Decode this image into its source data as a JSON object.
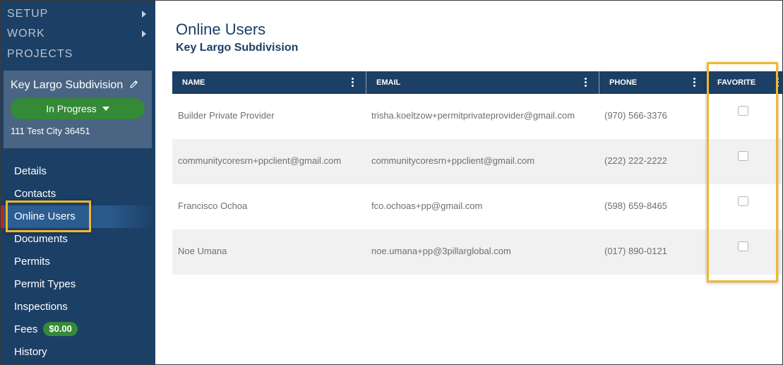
{
  "sidebar": {
    "top_nav": [
      {
        "label": "SETUP",
        "has_arrow": true
      },
      {
        "label": "WORK",
        "has_arrow": true
      },
      {
        "label": "PROJECTS",
        "has_arrow": false
      }
    ],
    "project": {
      "title": "Key Largo Subdivision",
      "edit_icon": "pencil-icon",
      "status": "In Progress",
      "address": "111 Test City 36451"
    },
    "items": [
      {
        "label": "Details"
      },
      {
        "label": "Contacts"
      },
      {
        "label": "Online Users",
        "active": true
      },
      {
        "label": "Documents"
      },
      {
        "label": "Permits"
      },
      {
        "label": "Permit Types"
      },
      {
        "label": "Inspections"
      },
      {
        "label": "Fees",
        "badge": "$0.00"
      },
      {
        "label": "History"
      }
    ]
  },
  "main": {
    "title": "Online Users",
    "subtitle": "Key Largo Subdivision",
    "table": {
      "columns": [
        "NAME",
        "EMAIL",
        "PHONE",
        "FAVORITE"
      ],
      "rows": [
        {
          "name": "Builder Private Provider",
          "email": "trisha.koeltzow+permitprivateprovider@gmail.com",
          "phone": "(970) 566-3376",
          "favorite": false
        },
        {
          "name": "communitycoresrn+ppclient@gmail.com",
          "email": "communitycoresrn+ppclient@gmail.com",
          "phone": "(222) 222-2222",
          "favorite": false
        },
        {
          "name": "Francisco Ochoa",
          "email": "fco.ochoas+pp@gmail.com",
          "phone": "(598) 659-8465",
          "favorite": false
        },
        {
          "name": "Noe Umana",
          "email": "noe.umana+pp@3pillarglobal.com",
          "phone": "(017) 890-0121",
          "favorite": false
        }
      ]
    }
  },
  "colors": {
    "sidebar_bg": "#1c3f66",
    "accent_green": "#348a37",
    "highlight_yellow": "#f1b82d",
    "header_bg": "#1c3f66"
  }
}
